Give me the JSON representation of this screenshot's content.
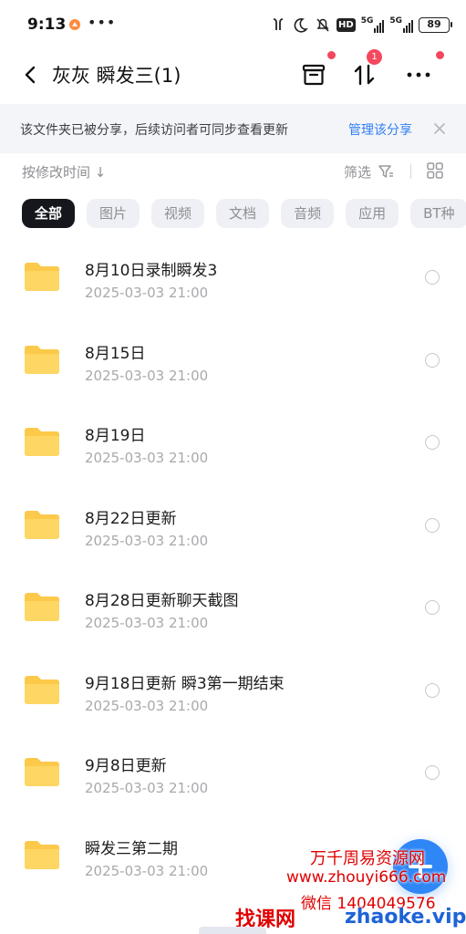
{
  "status_bar": {
    "time": "9:13",
    "dots": "•••",
    "battery": "89",
    "network_1": "5G",
    "network_2": "5G",
    "hd_label": "HD"
  },
  "header": {
    "title": "灰灰 瞬发三(1)",
    "transfer_badge": "1"
  },
  "banner": {
    "text": "该文件夹已被分享，后续访问者可同步查看更新",
    "link": "管理该分享"
  },
  "sort": {
    "label": "按修改时间 ↓",
    "filter_label": "筛选"
  },
  "tabs": [
    {
      "label": "全部",
      "active": true
    },
    {
      "label": "图片",
      "active": false
    },
    {
      "label": "视频",
      "active": false
    },
    {
      "label": "文档",
      "active": false
    },
    {
      "label": "音频",
      "active": false
    },
    {
      "label": "应用",
      "active": false
    },
    {
      "label": "BT种",
      "active": false
    }
  ],
  "files": [
    {
      "name": "8月10日录制瞬发3",
      "date": "2025-03-03  21:00"
    },
    {
      "name": "8月15日",
      "date": "2025-03-03  21:00"
    },
    {
      "name": "8月19日",
      "date": "2025-03-03  21:00"
    },
    {
      "name": "8月22日更新",
      "date": "2025-03-03  21:00"
    },
    {
      "name": "8月28日更新聊天截图",
      "date": "2025-03-03  21:00"
    },
    {
      "name": "9月18日更新 瞬3第一期结束",
      "date": "2025-03-03  21:00"
    },
    {
      "name": "9月8日更新",
      "date": "2025-03-03  21:00"
    },
    {
      "name": "瞬发三第二期",
      "date": "2025-03-03  21:00"
    }
  ],
  "watermark": {
    "line1": "万千周易资源网",
    "line2": "www.zhouyi666.com",
    "line3": "微信 1404049576",
    "line4": "找课网",
    "line5": "zhaoke.vip"
  },
  "colors": {
    "accent": "#2f7ef5",
    "folder": "#fcc94a",
    "badge": "#f4485f",
    "active_tab": "#15171c"
  },
  "icons": {
    "back": "chevron-left-icon",
    "archive": "archive-box-icon",
    "transfer": "up-down-arrows-icon",
    "more": "more-horizontal-icon",
    "close": "close-icon",
    "filter": "filter-icon",
    "grid": "grid-view-icon",
    "folder": "folder-icon",
    "add": "plus-icon"
  }
}
